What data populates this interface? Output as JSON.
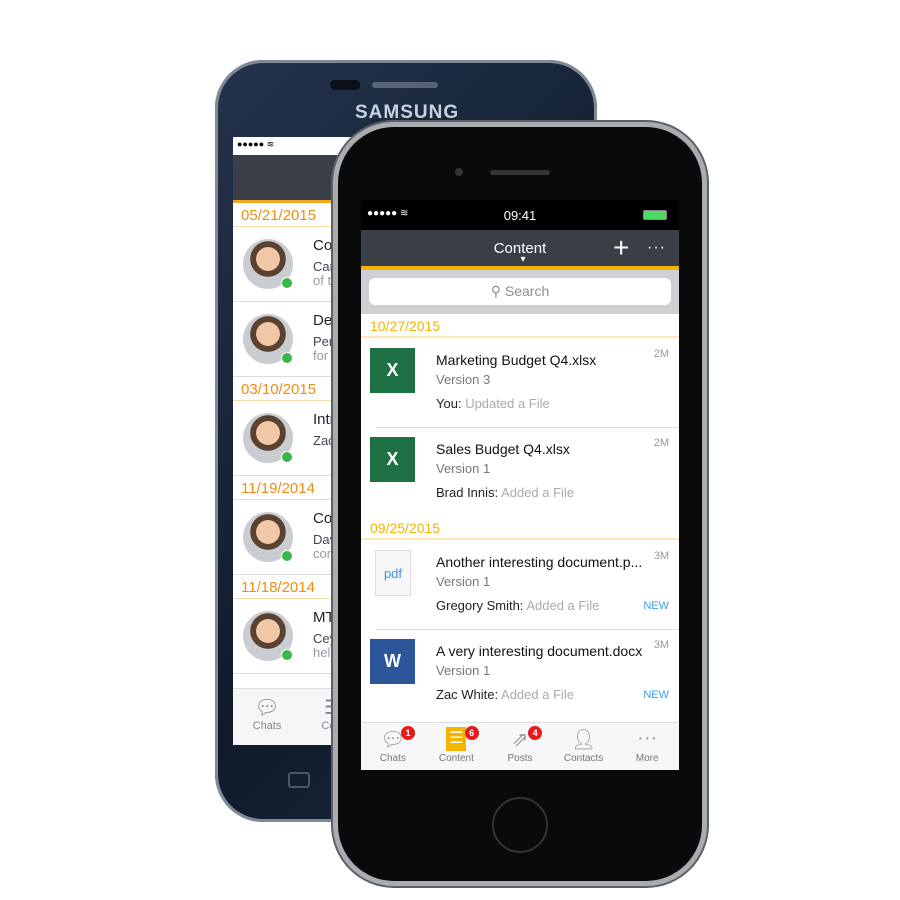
{
  "back_phone": {
    "brand": "SAMSUNG",
    "status_signal": "●●●●● ≋",
    "groups": [
      {
        "date": "05/21/2015",
        "items": [
          {
            "title": "Con",
            "line1": "Caro",
            "line2": "of th"
          },
          {
            "title": "Dep",
            "line1": "Perr",
            "line2": "for s"
          }
        ]
      },
      {
        "date": "03/10/2015",
        "items": [
          {
            "title": "Intro",
            "line1": "Zac",
            "line2": ""
          }
        ]
      },
      {
        "date": "11/19/2014",
        "items": [
          {
            "title": "Con",
            "line1": "Davi",
            "line2": "com"
          }
        ]
      },
      {
        "date": "11/18/2014",
        "items": [
          {
            "title": "MTe",
            "line1": "Ceyl",
            "line2": "help"
          }
        ]
      }
    ],
    "tabs": [
      {
        "label": "Chats",
        "icon": "chat-icon"
      },
      {
        "label": "Cont",
        "icon": "content-icon"
      }
    ]
  },
  "status": {
    "signal": "●●●●● ≋",
    "time": "09:41",
    "battery": "battery-charging-icon"
  },
  "header": {
    "title": "Content",
    "caret": "▾",
    "add": "+",
    "more": "···"
  },
  "search": {
    "placeholder": "Search"
  },
  "groups": [
    {
      "date": "10/27/2015",
      "items": [
        {
          "name": "Marketing Budget Q4.xlsx",
          "version": "Version 3",
          "actor": "You:",
          "action": "Updated a File",
          "size": "2M",
          "badge": "",
          "type": "excel",
          "icon_label": "X"
        },
        {
          "name": "Sales Budget Q4.xlsx",
          "version": "Version 1",
          "actor": "Brad Innis:",
          "action": "Added a File",
          "size": "2M",
          "badge": "",
          "type": "excel",
          "icon_label": "X"
        }
      ]
    },
    {
      "date": "09/25/2015",
      "items": [
        {
          "name": "Another interesting document.p...",
          "version": "Version 1",
          "actor": "Gregory Smith:",
          "action": "Added a File",
          "size": "3M",
          "badge": "NEW",
          "type": "pdf",
          "icon_label": "pdf"
        },
        {
          "name": "A very interesting document.docx",
          "version": "Version 1",
          "actor": "Zac White:",
          "action": "Added a File",
          "size": "3M",
          "badge": "NEW",
          "type": "word",
          "icon_label": "W"
        }
      ]
    }
  ],
  "tabs": [
    {
      "label": "Chats",
      "badge": "1",
      "icon": "chat-icon"
    },
    {
      "label": "Content",
      "badge": "6",
      "icon": "content-icon",
      "active": true
    },
    {
      "label": "Posts",
      "badge": "4",
      "icon": "posts-icon"
    },
    {
      "label": "Contacts",
      "badge": "",
      "icon": "contacts-icon"
    },
    {
      "label": "More",
      "badge": "",
      "icon": "more-icon"
    }
  ],
  "colors": {
    "accent": "#f5b400",
    "header": "#3a3f47",
    "excel": "#1e7145",
    "word": "#2b579a",
    "new": "#3aa0e8",
    "online": "#3cb54a",
    "badge": "#e41b1b"
  }
}
